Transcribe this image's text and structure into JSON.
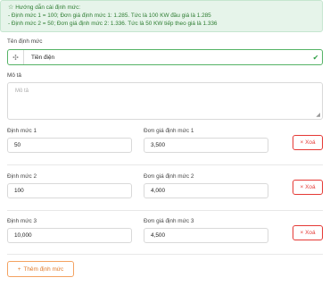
{
  "guide": {
    "title": "Hướng dẫn cài định mức:",
    "line1": "- Định mức 1 = 100; Đơn giá định mức 1: 1.285. Tức là 100 KW đầu giá là 1.285",
    "line2": "- Định mức 2 = 50; Đơn giá định mức 2: 1.336. Tức là 50 KW tiếp theo giá là 1.336"
  },
  "name": {
    "label": "Tên định mức",
    "value": "Tiền điện",
    "icon": "plus-icon"
  },
  "description": {
    "label": "Mô tả",
    "placeholder": "Mô tả"
  },
  "tiers": [
    {
      "quota_label": "Định mức 1",
      "quota_value": "50",
      "price_label": "Đơn giá định mức 1",
      "price_value": "3,500",
      "delete_label": "Xoá"
    },
    {
      "quota_label": "Định mức 2",
      "quota_value": "100",
      "price_label": "Đơn giá định mức 2",
      "price_value": "4,000",
      "delete_label": "Xoá"
    },
    {
      "quota_label": "Định mức 3",
      "quota_value": "10,000",
      "price_label": "Đơn giá định mức 3",
      "price_value": "4,500",
      "delete_label": "Xoá"
    }
  ],
  "add_button": {
    "label": "Thêm định mức"
  },
  "colors": {
    "accent_green": "#2e9e44",
    "danger": "#e53935",
    "add_orange": "#e07a2a"
  }
}
